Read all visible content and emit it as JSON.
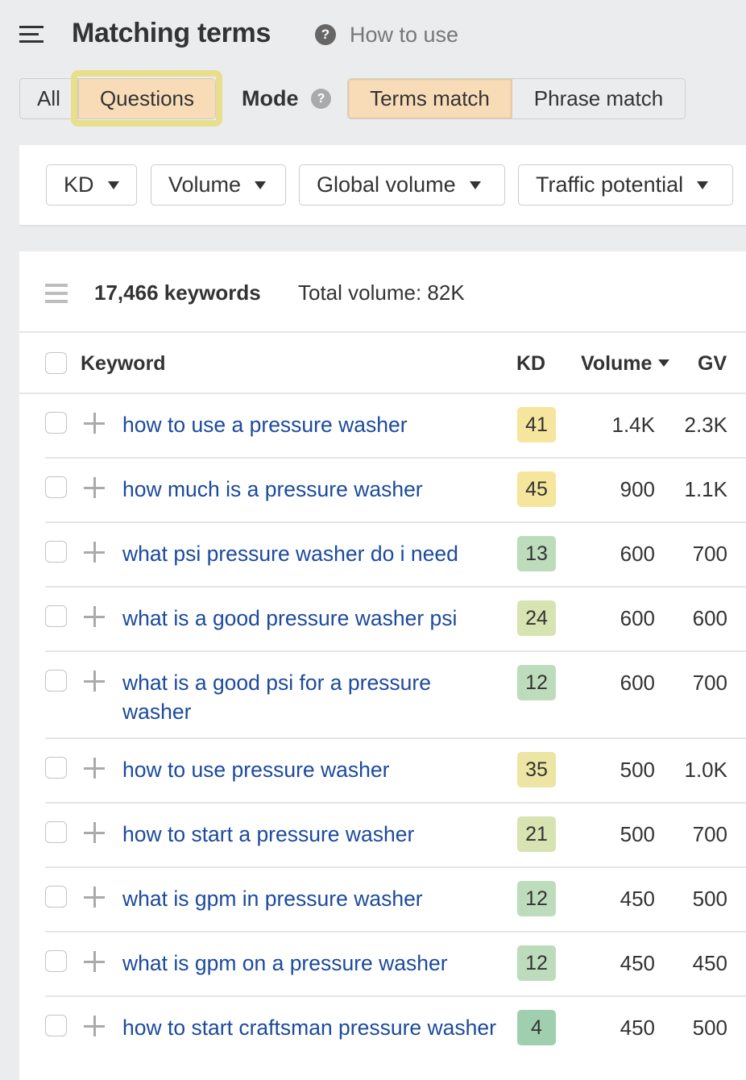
{
  "header": {
    "title": "Matching terms",
    "help_icon": "question-circle-icon",
    "how_to_use": "How to use"
  },
  "type_toggle": {
    "options": [
      {
        "label": "All",
        "active": false
      },
      {
        "label": "Questions",
        "active": true
      }
    ]
  },
  "mode": {
    "label": "Mode",
    "help_icon": "question-circle-icon",
    "options": [
      {
        "label": "Terms match",
        "active": true
      },
      {
        "label": "Phrase match",
        "active": false
      }
    ]
  },
  "filters": [
    {
      "label": "KD"
    },
    {
      "label": "Volume"
    },
    {
      "label": "Global volume"
    },
    {
      "label": "Traffic potential"
    }
  ],
  "summary": {
    "keyword_count": "17,466 keywords",
    "total_volume": "Total volume: 82K"
  },
  "table": {
    "columns": {
      "keyword": "Keyword",
      "kd": "KD",
      "volume": "Volume",
      "gv": "GV"
    },
    "sorted_by": "Volume",
    "sort_direction": "desc",
    "rows": [
      {
        "keyword": "how to use a pressure washer",
        "kd": "41",
        "kd_color": "#f6e59d",
        "volume": "1.4K",
        "gv": "2.3K"
      },
      {
        "keyword": "how much is a pressure washer",
        "kd": "45",
        "kd_color": "#f6e59d",
        "volume": "900",
        "gv": "1.1K"
      },
      {
        "keyword": "what psi pressure washer do i need",
        "kd": "13",
        "kd_color": "#bddcbb",
        "volume": "600",
        "gv": "700"
      },
      {
        "keyword": "what is a good pressure washer psi",
        "kd": "24",
        "kd_color": "#d7e3b1",
        "volume": "600",
        "gv": "600"
      },
      {
        "keyword": "what is a good psi for a pressure washer",
        "kd": "12",
        "kd_color": "#bddcbb",
        "volume": "600",
        "gv": "700"
      },
      {
        "keyword": "how to use pressure washer",
        "kd": "35",
        "kd_color": "#ece5a3",
        "volume": "500",
        "gv": "1.0K"
      },
      {
        "keyword": "how to start a pressure washer",
        "kd": "21",
        "kd_color": "#d7e3b1",
        "volume": "500",
        "gv": "700"
      },
      {
        "keyword": "what is gpm in pressure washer",
        "kd": "12",
        "kd_color": "#bddcbb",
        "volume": "450",
        "gv": "500"
      },
      {
        "keyword": "what is gpm on a pressure washer",
        "kd": "12",
        "kd_color": "#bddcbb",
        "volume": "450",
        "gv": "450"
      },
      {
        "keyword": "how to start craftsman pressure washer",
        "kd": "4",
        "kd_color": "#9fcfae",
        "volume": "450",
        "gv": "500"
      }
    ]
  },
  "colors": {
    "active_toggle": "#f8dcb8",
    "highlight": "#e8df8d",
    "link": "#1c4a9c"
  }
}
